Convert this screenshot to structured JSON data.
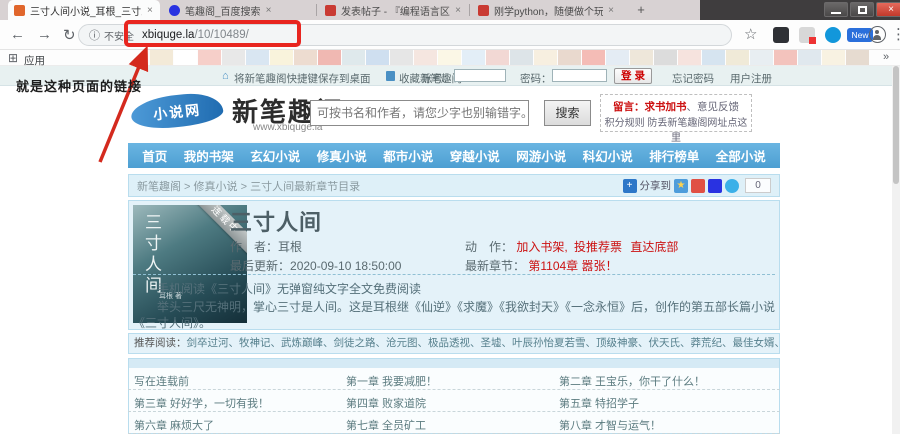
{
  "icons": {
    "back": "←",
    "forward": "→",
    "reload": "↻",
    "info": "ⓘ",
    "star": "☆",
    "menu_dots": "⋮",
    "plus": "+",
    "close_x": "×",
    "grid": "⊞",
    "overflow": "»",
    "home": "⌂",
    "qzone_star": "★",
    "share_plus": "+"
  },
  "browser": {
    "tabs": [
      {
        "title": "三寸人间小说_耳根_三寸人间最新"
      },
      {
        "title": "笔趣阁_百度搜索"
      },
      {
        "title": "发表帖子 - 『编程语言区』- 看"
      },
      {
        "title": "刚学python，随便做个玩 - [编"
      }
    ],
    "url": {
      "security": "不安全",
      "host": "xbiquge.la",
      "path": "/10/10489/"
    },
    "new_badge": "New",
    "apps_label": "应用",
    "favicon_palette": [
      "#f3ead8",
      "#ffffff",
      "#f6cfc9",
      "#e8e8e8",
      "#d9e6f2",
      "#f9f3dc",
      "#eddcd0",
      "#f0b8b2",
      "#dfe9ec",
      "#cfdff0",
      "#e6e6e6",
      "#f5e6e0",
      "#fbf7e6",
      "#e3eef7",
      "#f2d8d4",
      "#dde4e8",
      "#f7efe0",
      "#e9d9ce",
      "#f4bcb6",
      "#e4ecf4",
      "#eee7da",
      "#dcdcdc",
      "#f6e3de",
      "#d6e4f0",
      "#f0ead8",
      "#e8eef2",
      "#f3c3bd",
      "#e0e8ee",
      "#f8f2e2",
      "#e6dbd0"
    ]
  },
  "annotation": {
    "note": "就是这种页面的链接"
  },
  "site": {
    "topbar": {
      "save_shortcut": "将新笔趣阁快捷键保存到桌面",
      "favorite": "收藏新笔趣阁",
      "account_label": "账号：",
      "password_label": "密码：",
      "login": "登 录",
      "forgot": "忘记密码",
      "register": "用户注册"
    },
    "header": {
      "logo_small": "小说网",
      "logo_main": "新笔趣阁",
      "logo_url": "www.xbiquge.la",
      "search_placeholder": "可按书名和作者，请您少字也别输错字。",
      "search_button": "搜索",
      "notice_line1_red": "留言：求书加书",
      "notice_line1_rest": "、意见反馈",
      "notice_line2": "积分规则 防丢新笔趣阁网址点这里"
    },
    "nav": [
      "首页",
      "我的书架",
      "玄幻小说",
      "修真小说",
      "都市小说",
      "穿越小说",
      "网游小说",
      "科幻小说",
      "排行榜单",
      "全部小说"
    ],
    "breadcrumb": {
      "path": "新笔趣阁 > 修真小说 > 三寸人间最新章节目录",
      "share_label": "分享到",
      "share_count": "0"
    },
    "book": {
      "title": "三寸人间",
      "ribbon": "连载中",
      "cover_title": "三寸人间",
      "cover_author": "耳根 著",
      "author_label": "作　者：",
      "author": "耳根",
      "action_label": "动　作：",
      "action1": "加入书架,",
      "action2": "投推荐票",
      "action3": "直达底部",
      "updated_label": "最后更新：",
      "updated": "2020-09-10 18:50:00",
      "latest_label": "最新章节：",
      "latest": "第1104章 嚣张！",
      "desc1": "手机阅读《三寸人间》无弹窗纯文字全文免费阅读",
      "desc2": "举头三尺无神明，掌心三寸是人间。这是耳根继《仙逆》《求魔》《我欲封天》《一念永恒》后，创作的第五部长篇小说《三寸人间》。"
    },
    "recommend": {
      "label": "推荐阅读：",
      "items": "剑卒过河、牧神记、武炼巅峰、剑徒之路、沧元图、极品透视、圣墟、叶辰孙怡夏若雪、顶级神豪、伏天氏、莽荒纪、最佳女婿、全职法师、万古神帝、元尊"
    },
    "chapters": [
      [
        "写在连载前",
        "第一章 我要减肥！",
        "第二章 王宝乐，你干了什么！"
      ],
      [
        "第三章 好好学，一切有我！",
        "第四章 败家道院",
        "第五章 特招学子"
      ],
      [
        "第六章 麻烦大了",
        "第七章 全员矿工",
        "第八章 才智与运气！"
      ]
    ]
  }
}
